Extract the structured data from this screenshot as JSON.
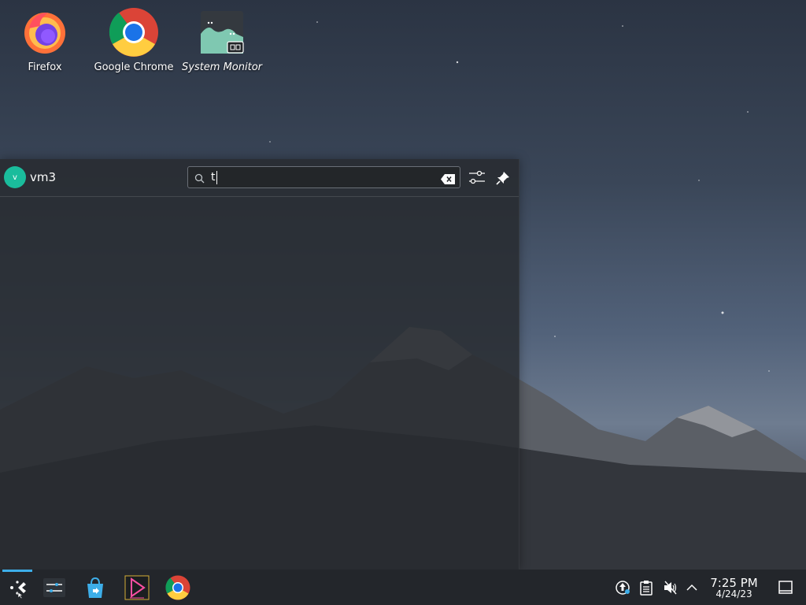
{
  "desktop": {
    "icons": [
      {
        "label": "Firefox",
        "icon": "firefox-icon"
      },
      {
        "label": "Google Chrome",
        "icon": "chrome-icon"
      },
      {
        "label": "System Monitor",
        "icon": "system-monitor-icon"
      }
    ]
  },
  "launcher": {
    "user": {
      "initial": "v",
      "name": "vm3"
    },
    "search": {
      "value": "t"
    }
  },
  "taskbar": {
    "apps": [
      "application-launcher-icon",
      "settings-icon",
      "discover-store-icon",
      "media-player-icon",
      "chrome-icon"
    ],
    "tray": [
      "updates-icon",
      "clipboard-icon",
      "volume-muted-icon",
      "expand-tray-icon"
    ],
    "clock": {
      "time": "7:25 PM",
      "date": "4/24/23"
    },
    "show_desktop": "show-desktop-icon"
  },
  "colors": {
    "accent": "#3daee9",
    "panel": "#23262b",
    "avatar": "#1abc9c"
  }
}
